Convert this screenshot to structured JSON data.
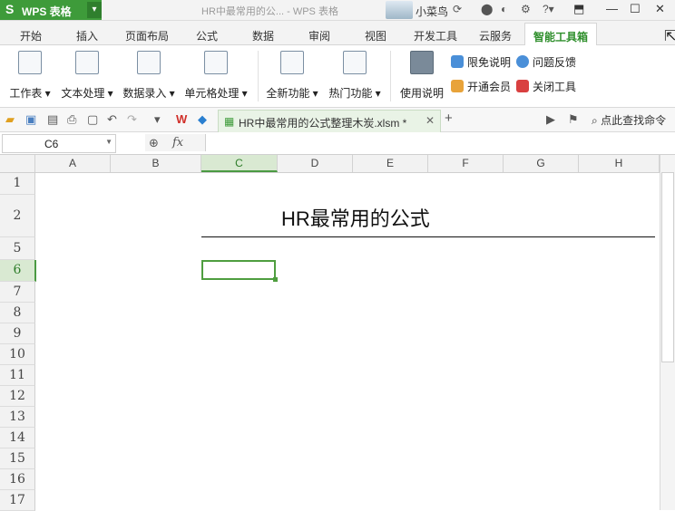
{
  "titlebar": {
    "app_name": "WPS 表格",
    "doc_title": "HR中最常用的公... - WPS 表格",
    "user": "小菜鸟"
  },
  "menu": {
    "tabs": [
      "开始",
      "插入",
      "页面布局",
      "公式",
      "数据",
      "审阅",
      "视图",
      "开发工具",
      "云服务"
    ],
    "active_tab": "智能工具箱"
  },
  "ribbon": {
    "buttons": [
      "工作表",
      "文本处理",
      "数据录入",
      "单元格处理",
      "全新功能",
      "热门功能",
      "使用说明"
    ],
    "small": [
      "限免说明",
      "问题反馈",
      "开通会员",
      "关闭工具"
    ]
  },
  "quickbar": {
    "doc_tab": "HR中最常用的公式整理木炭.xlsm *",
    "find": "点此查找命令"
  },
  "formula_bar": {
    "cell_ref": "C6",
    "fx": "fx",
    "content": ""
  },
  "grid": {
    "columns": [
      "A",
      "B",
      "C",
      "D",
      "E",
      "F",
      "G",
      "H"
    ],
    "rows": [
      "1",
      "2",
      "5",
      "6",
      "7",
      "8",
      "9",
      "10",
      "11",
      "12",
      "13",
      "14",
      "15",
      "16",
      "17"
    ],
    "selected_column": "C",
    "selected_row": "6"
  },
  "sheet": {
    "title": "HR最常用的公式"
  },
  "colors": {
    "brand": "#3e9b3a",
    "accent": "#2f8f2c",
    "selection": "#4f9e3f"
  }
}
